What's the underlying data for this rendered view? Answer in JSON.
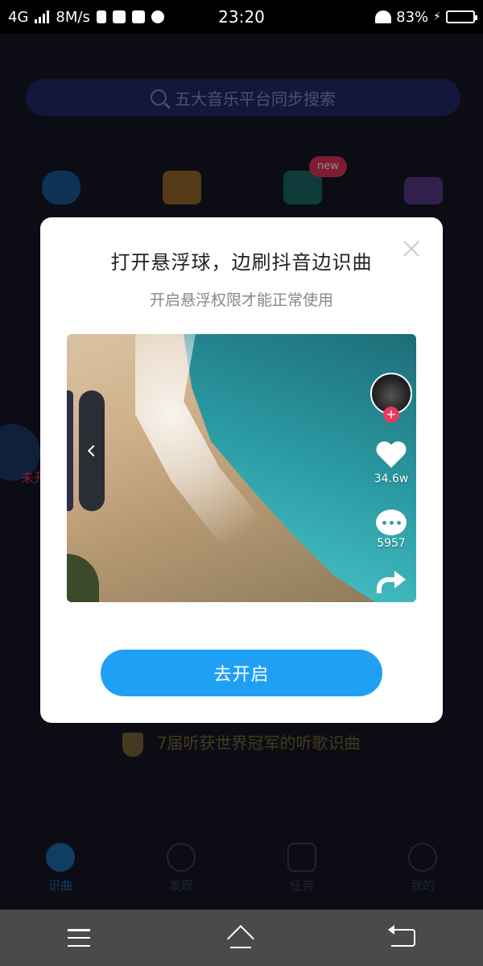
{
  "status_bar": {
    "network": "4G",
    "speed": "8M/s",
    "time": "23:20",
    "battery_percent": "83%",
    "battery_level": 0.83
  },
  "background": {
    "search_placeholder": "五大音乐平台同步搜索",
    "new_badge": "new",
    "trophy_text": "7届听获世界冠军的听歌识曲",
    "tabs": [
      {
        "label": "识曲",
        "icon": "music-note-icon",
        "active": true
      },
      {
        "label": "发现",
        "icon": "planet-icon",
        "active": false
      },
      {
        "label": "任务",
        "icon": "task-shield-icon",
        "active": false
      },
      {
        "label": "我的",
        "icon": "smile-face-icon",
        "active": false
      }
    ],
    "side_fab_label": "未开"
  },
  "modal": {
    "title": "打开悬浮球，边刷抖音边识曲",
    "subtitle": "开启悬浮权限才能正常使用",
    "likes": "34.6w",
    "comments": "5957",
    "button_label": "去开启"
  },
  "colors": {
    "primary_button": "#1fa0f5",
    "follow_badge": "#f0365a",
    "new_badge": "#e8345a"
  }
}
